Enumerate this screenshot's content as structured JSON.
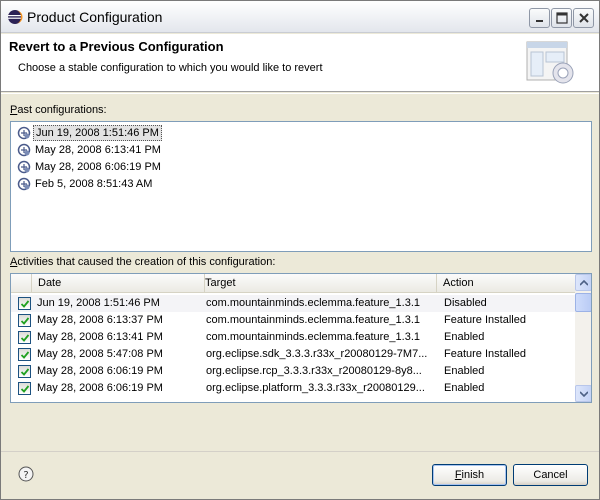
{
  "window": {
    "title": "Product Configuration"
  },
  "header": {
    "title": "Revert to a Previous Configuration",
    "description": "Choose a stable configuration to which you would like to revert"
  },
  "past_configs": {
    "label_mnemonic": "P",
    "label_rest": "ast configurations:",
    "items": [
      {
        "label": "Jun 19, 2008 1:51:46 PM",
        "selected": true
      },
      {
        "label": "May 28, 2008 6:13:41 PM",
        "selected": false
      },
      {
        "label": "May 28, 2008 6:06:19 PM",
        "selected": false
      },
      {
        "label": "Feb 5, 2008 8:51:43 AM",
        "selected": false
      }
    ]
  },
  "activities": {
    "label_mnemonic": "A",
    "label_rest": "ctivities that caused the creation of this configuration:",
    "columns": [
      "Date",
      "Target",
      "Action"
    ],
    "rows": [
      {
        "date": "Jun 19, 2008 1:51:46 PM",
        "target": "com.mountainminds.eclemma.feature_1.3.1",
        "action": "Disabled",
        "checked": true
      },
      {
        "date": "May 28, 2008 6:13:37 PM",
        "target": "com.mountainminds.eclemma.feature_1.3.1",
        "action": "Feature Installed",
        "checked": true
      },
      {
        "date": "May 28, 2008 6:13:41 PM",
        "target": "com.mountainminds.eclemma.feature_1.3.1",
        "action": "Enabled",
        "checked": true
      },
      {
        "date": "May 28, 2008 5:47:08 PM",
        "target": "org.eclipse.sdk_3.3.3.r33x_r20080129-7M7...",
        "action": "Feature Installed",
        "checked": true
      },
      {
        "date": "May 28, 2008 6:06:19 PM",
        "target": "org.eclipse.rcp_3.3.3.r33x_r20080129-8y8...",
        "action": "Enabled",
        "checked": true
      },
      {
        "date": "May 28, 2008 6:06:19 PM",
        "target": "org.eclipse.platform_3.3.3.r33x_r20080129...",
        "action": "Enabled",
        "checked": true
      }
    ]
  },
  "footer": {
    "finish_mnemonic": "F",
    "finish_rest": "inish",
    "cancel_label": "Cancel"
  },
  "icons": {
    "app": "eclipse-icon",
    "config": "configuration-icon",
    "help": "help-icon"
  }
}
